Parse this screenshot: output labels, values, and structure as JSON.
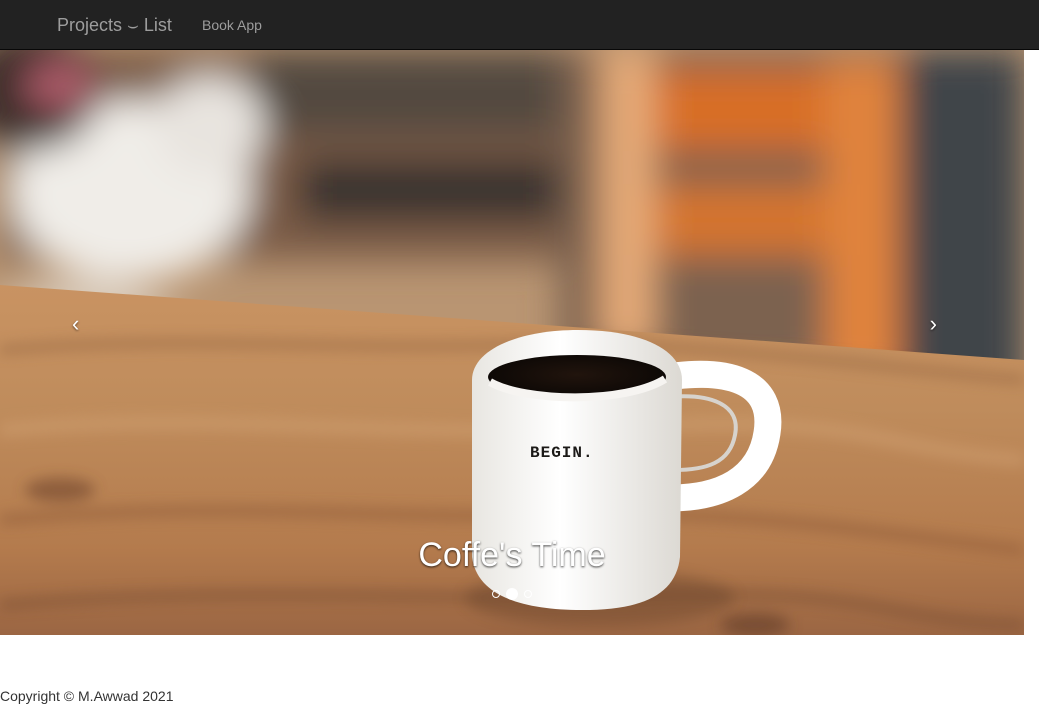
{
  "navbar": {
    "brand": "Projects ⌣ List",
    "links": [
      {
        "label": "Book App"
      }
    ]
  },
  "carousel": {
    "caption": "Coffe's Time",
    "active_slide": 2,
    "slide_count": 3,
    "mug_text": "BEGIN.",
    "controls": {
      "previous": "‹",
      "next": "›"
    }
  },
  "footer": {
    "copyright": "Copyright © M.Awwad 2021"
  },
  "colors": {
    "navbar_background": "#222222",
    "navbar_text": "#9d9d9d",
    "caption_text": "#ffffff",
    "footer_text": "#333333"
  },
  "icons": {
    "previous": "chevron-left-icon",
    "next": "chevron-right-icon"
  }
}
